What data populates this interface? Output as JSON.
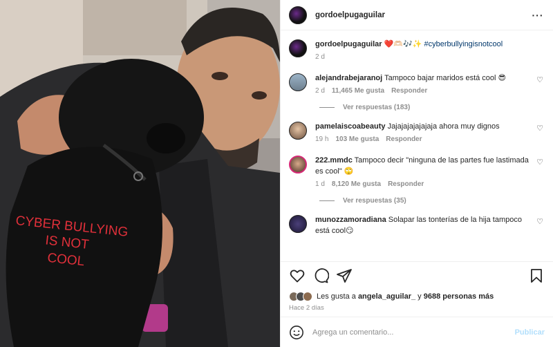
{
  "post": {
    "author": "gordoelpugaguilar",
    "caption_text": "❤️🫶🏻🎶✨",
    "caption_hashtag": "#cyberbullyingisnotcool",
    "caption_time": "2 d",
    "shirt_text_line1": "CYBER BULLYING",
    "shirt_text_line2": "IS NOT",
    "shirt_text_line3": "COOL"
  },
  "labels": {
    "reply": "Responder"
  },
  "comments": [
    {
      "user": "alejandrabejaranoj",
      "text": "Tampoco bajar maridos está cool 😎",
      "time": "2 d",
      "likes": "11,465 Me gusta",
      "replies": "Ver respuestas (183)"
    },
    {
      "user": "pamelaiscoabeauty",
      "text": "Jajajajajajajaja ahora muy dignos",
      "time": "19 h",
      "likes": "103 Me gusta"
    },
    {
      "user": "222.mmdc",
      "text": "Tampoco decir \"ninguna de las partes fue lastimada es cool\" 🙄",
      "time": "1 d",
      "likes": "8,120 Me gusta",
      "replies": "Ver respuestas (35)"
    },
    {
      "user": "munozzamoradiana",
      "text": "Solapar las tonterías de la hija tampoco está cool😏"
    }
  ],
  "likes": {
    "prefix": "Les gusta a",
    "user": "angela_aguilar_",
    "connector": "y",
    "others": "9688 personas más"
  },
  "time_ago": "Hace 2 días",
  "add_comment": {
    "placeholder": "Agrega un comentario...",
    "publish": "Publicar"
  },
  "colors": {
    "hashtag": "#00376b",
    "shirt_text": "#e0303a",
    "publish_disabled": "#b2dffc"
  },
  "icons": [
    "more-icon",
    "heart-icon",
    "comment-icon",
    "share-icon",
    "bookmark-icon",
    "emoji-icon"
  ]
}
